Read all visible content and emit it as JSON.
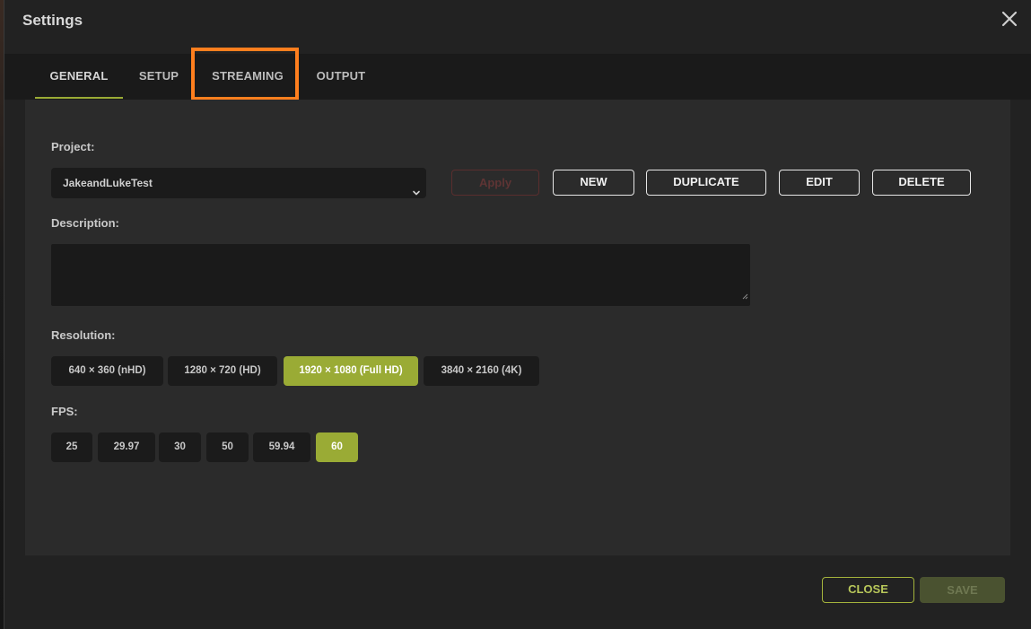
{
  "window": {
    "title": "Settings"
  },
  "tabs": [
    {
      "label": "GENERAL"
    },
    {
      "label": "SETUP"
    },
    {
      "label": "STREAMING"
    },
    {
      "label": "OUTPUT"
    }
  ],
  "active_tab": "GENERAL",
  "project": {
    "label": "Project:",
    "selected": "JakeandLukeTest",
    "apply_label": "Apply",
    "new_label": "NEW",
    "duplicate_label": "DUPLICATE",
    "edit_label": "EDIT",
    "delete_label": "DELETE"
  },
  "description": {
    "label": "Description:",
    "value": ""
  },
  "resolution": {
    "label": "Resolution:",
    "options": [
      "640 × 360 (nHD)",
      "1280 × 720 (HD)",
      "1920 × 1080 (Full HD)",
      "3840 × 2160 (4K)"
    ],
    "selected": "1920 × 1080 (Full HD)"
  },
  "fps": {
    "label": "FPS:",
    "options": [
      "25",
      "29.97",
      "30",
      "50",
      "59.94",
      "60"
    ],
    "selected": "60"
  },
  "footer": {
    "close_label": "CLOSE",
    "save_label": "SAVE"
  },
  "colors": {
    "accent": "#9aab35",
    "highlight": "#ff7f1e",
    "background": "#222222"
  }
}
